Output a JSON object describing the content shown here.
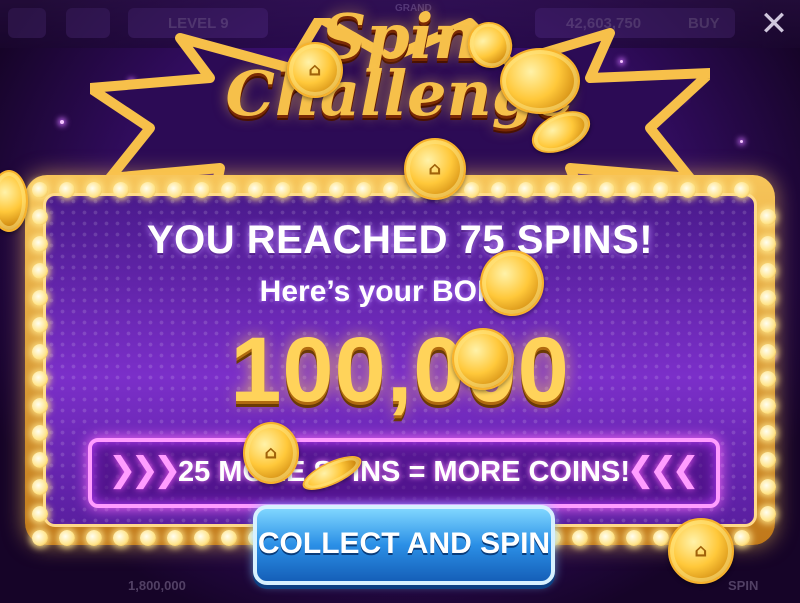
{
  "top_bar": {
    "level_label": "LEVEL 9",
    "grand_label": "GRAND",
    "balance": "42,603,750",
    "buy_label": "BUY",
    "close_label": "✕"
  },
  "popup": {
    "title_line1": "Spin",
    "title_line2": "Challenge",
    "headline": "YOU REACHED 75 SPINS!",
    "subline": "Here’s your BONUS",
    "bonus_amount": "100,000",
    "promo_chevrons_left": "❯❯❯",
    "promo_text": "25 MORE SPINS = MORE COINS!",
    "promo_chevrons_right": "❮❮❮",
    "cta_label": "COLLECT AND SPIN"
  },
  "underlay": {
    "bottom_left_value": "1,800,000",
    "bottom_right_label": "SPIN"
  },
  "colors": {
    "gold": "#f6c04a",
    "purple_bg": "#4a1a8c",
    "promo_pink": "#ff9cff",
    "cta_blue": "#2b8fe6"
  },
  "icons": [
    "home-icon",
    "close-icon",
    "coin-icon",
    "sparkle-icon"
  ]
}
